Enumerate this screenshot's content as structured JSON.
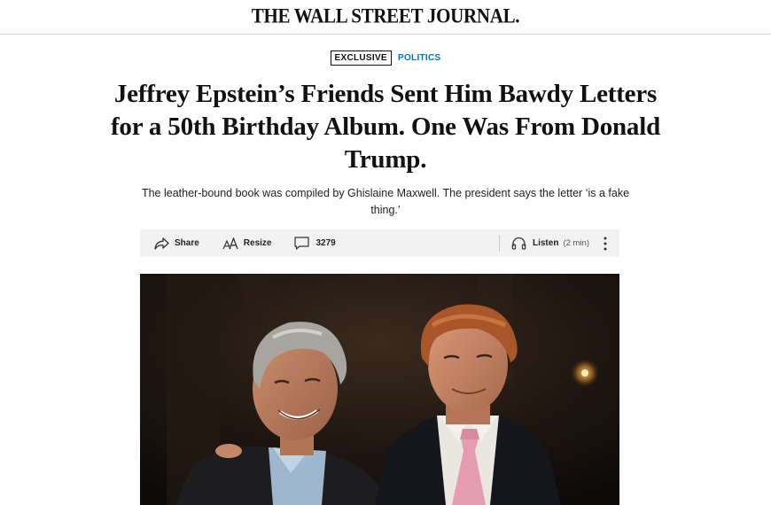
{
  "masthead": {
    "logo_text": "THE WALL STREET JOURNAL."
  },
  "article": {
    "flag_exclusive": "EXCLUSIVE",
    "flag_section": "POLITICS",
    "headline": "Jeffrey Epstein’s Friends Sent Him Bawdy Letters for a 50th Birthday Album. One Was From Donald Trump.",
    "dek": "The leather-bound book was compiled by Ghislaine Maxwell. The president says the letter ‘is a fake thing.’"
  },
  "toolbar": {
    "share_label": "Share",
    "resize_label": "Resize",
    "comments_count": "3279",
    "listen_label": "Listen",
    "listen_duration": "(2 min)",
    "icons": [
      "share-icon",
      "resize-icon",
      "comment-icon",
      "headphones-icon",
      "more-vertical-icon"
    ]
  },
  "photo": {
    "description_icon": "article-photo"
  },
  "colors": {
    "section_flag": "#0274b6",
    "toolbar_bg": "#f2f2f2"
  }
}
